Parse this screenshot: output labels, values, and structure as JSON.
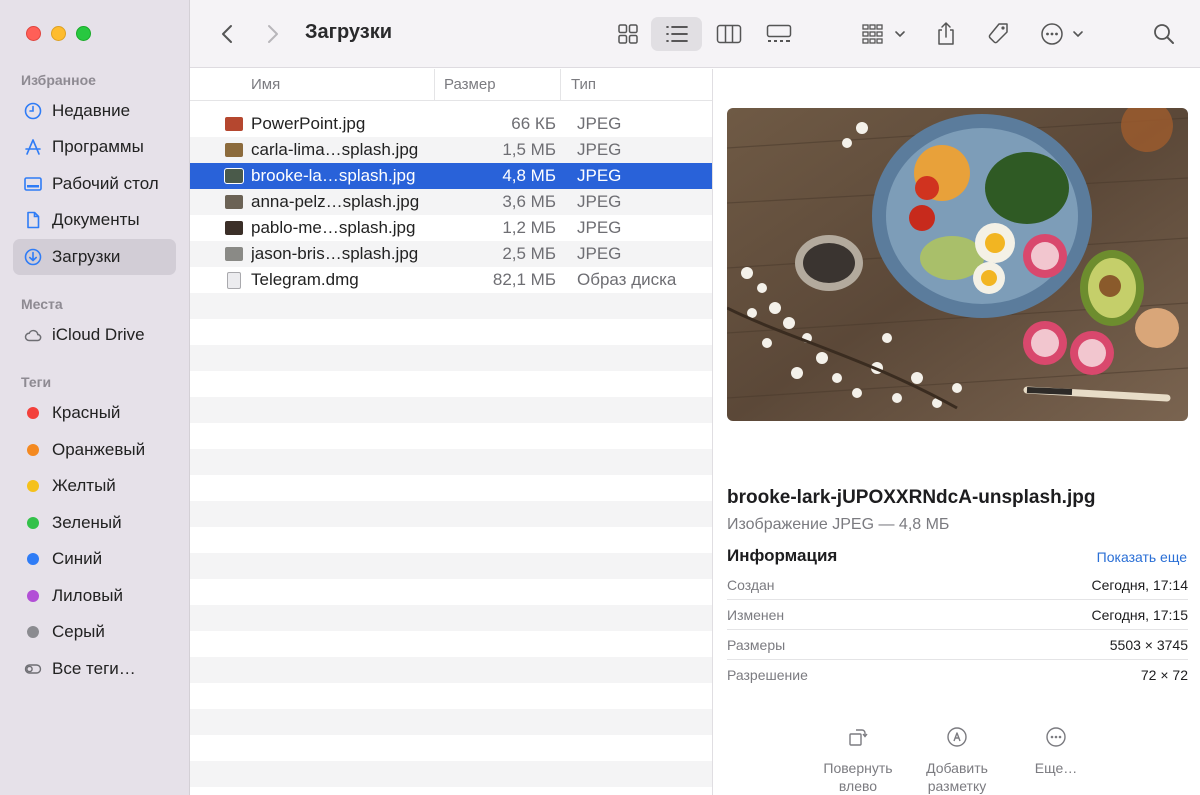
{
  "window": {
    "title": "Загрузки"
  },
  "sidebar": {
    "favorites_label": "Избранное",
    "favorites": [
      {
        "label": "Недавние",
        "icon": "clock-icon"
      },
      {
        "label": "Программы",
        "icon": "apps-icon"
      },
      {
        "label": "Рабочий стол",
        "icon": "desktop-icon"
      },
      {
        "label": "Документы",
        "icon": "document-icon"
      },
      {
        "label": "Загрузки",
        "icon": "download-icon",
        "active": true
      }
    ],
    "places_label": "Места",
    "places": [
      {
        "label": "iCloud Drive",
        "icon": "cloud-icon"
      }
    ],
    "tags_label": "Теги",
    "tags": [
      {
        "label": "Красный",
        "color": "#f3403b"
      },
      {
        "label": "Оранжевый",
        "color": "#f48920"
      },
      {
        "label": "Желтый",
        "color": "#f5c11b"
      },
      {
        "label": "Зеленый",
        "color": "#33c14a"
      },
      {
        "label": "Синий",
        "color": "#2f7cf6"
      },
      {
        "label": "Лиловый",
        "color": "#b24fd6"
      },
      {
        "label": "Серый",
        "color": "#8b8b90"
      }
    ],
    "all_tags": "Все теги…"
  },
  "list": {
    "headers": {
      "name": "Имя",
      "size": "Размер",
      "type": "Тип"
    },
    "rows": [
      {
        "name": "PowerPoint.jpg",
        "size": "66 КБ",
        "type": "JPEG",
        "thumb": "#b5472f"
      },
      {
        "name": "carla-lima…splash.jpg",
        "size": "1,5 МБ",
        "type": "JPEG",
        "thumb": "#8c6b3c"
      },
      {
        "name": "brooke-la…splash.jpg",
        "size": "4,8 МБ",
        "type": "JPEG",
        "thumb": "#4a5a4a",
        "selected": true
      },
      {
        "name": "anna-pelz…splash.jpg",
        "size": "3,6 МБ",
        "type": "JPEG",
        "thumb": "#6b6255"
      },
      {
        "name": "pablo-me…splash.jpg",
        "size": "1,2 МБ",
        "type": "JPEG",
        "thumb": "#3b2f28"
      },
      {
        "name": "jason-bris…splash.jpg",
        "size": "2,5 МБ",
        "type": "JPEG",
        "thumb": "#8a8a86"
      },
      {
        "name": "Telegram.dmg",
        "size": "82,1 МБ",
        "type": "Образ диска",
        "thumb": "#d8d8dc"
      }
    ]
  },
  "preview": {
    "filename": "brooke-lark-jUPOXXRNdcA-unsplash.jpg",
    "subtitle": "Изображение JPEG — 4,8 МБ",
    "info_title": "Информация",
    "show_more": "Показать еще",
    "meta": [
      {
        "key": "Создан",
        "value": "Сегодня, 17:14"
      },
      {
        "key": "Изменен",
        "value": "Сегодня, 17:15"
      },
      {
        "key": "Размеры",
        "value": "5503 × 3745"
      },
      {
        "key": "Разрешение",
        "value": "72 × 72"
      }
    ],
    "actions": [
      {
        "label": "Повернуть влево",
        "icon": "rotate-left-icon"
      },
      {
        "label": "Добавить разметку",
        "icon": "markup-icon"
      },
      {
        "label": "Еще…",
        "icon": "more-icon"
      }
    ]
  }
}
